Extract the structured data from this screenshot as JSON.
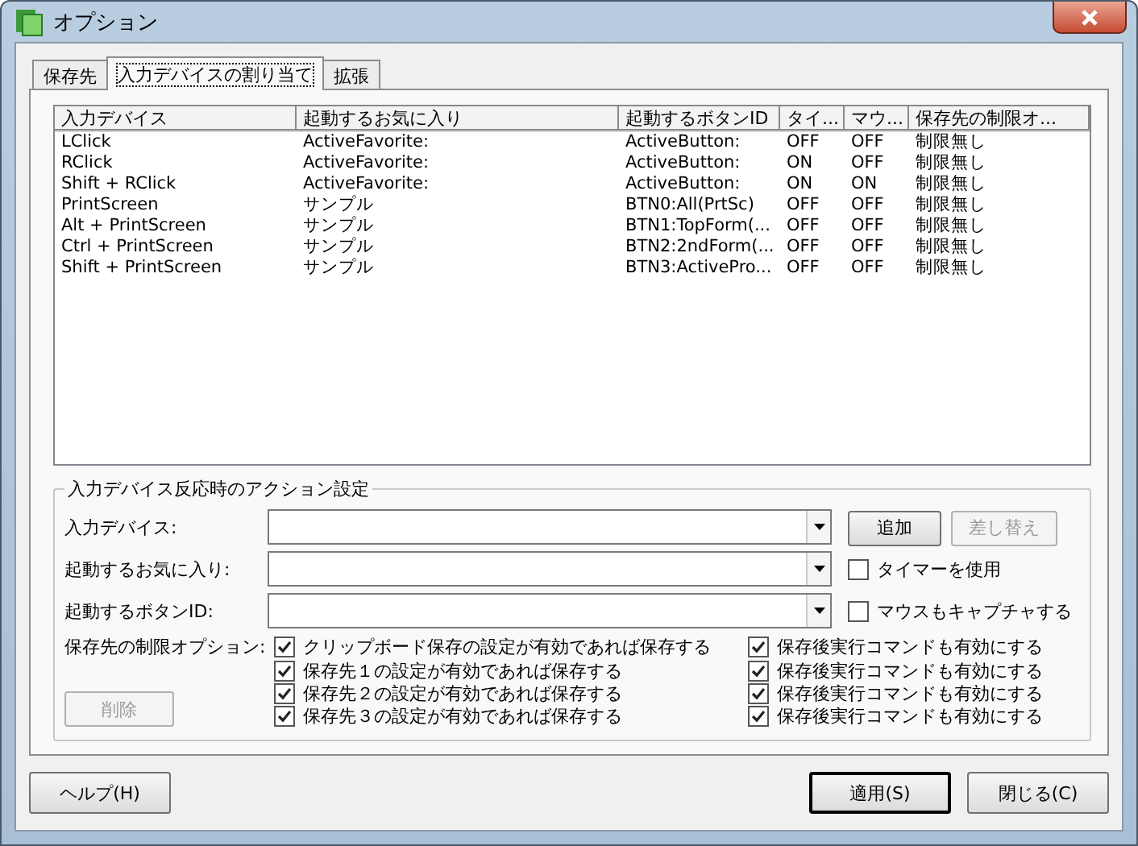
{
  "window": {
    "title": "オプション"
  },
  "tabs": [
    {
      "label": "保存先",
      "selected": false
    },
    {
      "label": "入力デバイスの割り当て",
      "selected": true
    },
    {
      "label": "拡張",
      "selected": false
    }
  ],
  "list": {
    "columns": [
      "入力デバイス",
      "起動するお気に入り",
      "起動するボタンID",
      "タイ...",
      "マウ...",
      "保存先の制限オ..."
    ],
    "rows": [
      [
        "LClick",
        "ActiveFavorite:",
        "ActiveButton:",
        "OFF",
        "OFF",
        "制限無し"
      ],
      [
        "RClick",
        "ActiveFavorite:",
        "ActiveButton:",
        "ON",
        "OFF",
        "制限無し"
      ],
      [
        "Shift + RClick",
        "ActiveFavorite:",
        "ActiveButton:",
        "ON",
        "ON",
        "制限無し"
      ],
      [
        "PrintScreen",
        "サンプル",
        "BTN0:All(PrtSc)",
        "OFF",
        "OFF",
        "制限無し"
      ],
      [
        "Alt + PrintScreen",
        "サンプル",
        "BTN1:TopForm(...",
        "OFF",
        "OFF",
        "制限無し"
      ],
      [
        "Ctrl + PrintScreen",
        "サンプル",
        "BTN2:2ndForm(...",
        "OFF",
        "OFF",
        "制限無し"
      ],
      [
        "Shift + PrintScreen",
        "サンプル",
        "BTN3:ActivePro...",
        "OFF",
        "OFF",
        "制限無し"
      ]
    ]
  },
  "action_group": {
    "title": "入力デバイス反応時のアクション設定",
    "fields": [
      {
        "label": "入力デバイス:"
      },
      {
        "label": "起動するお気に入り:"
      },
      {
        "label": "起動するボタンID:"
      }
    ],
    "side": [
      {
        "kind": "button",
        "label": "追加",
        "disabled": false
      },
      {
        "kind": "button",
        "label": "差し替え",
        "disabled": true
      },
      {
        "kind": "checkbox",
        "label": "タイマーを使用",
        "checked": false
      },
      {
        "kind": "checkbox",
        "label": "マウスもキャプチャする",
        "checked": false
      }
    ],
    "restriction_label": "保存先の制限オプション:",
    "options": [
      {
        "label": "クリップボード保存の設定が有効であれば保存する",
        "checked": true,
        "command": {
          "label": "保存後実行コマンドも有効にする",
          "checked": true
        }
      },
      {
        "label": "保存先１の設定が有効であれば保存する",
        "checked": true,
        "command": {
          "label": "保存後実行コマンドも有効にする",
          "checked": true
        }
      },
      {
        "label": "保存先２の設定が有効であれば保存する",
        "checked": true,
        "command": {
          "label": "保存後実行コマンドも有効にする",
          "checked": true
        }
      },
      {
        "label": "保存先３の設定が有効であれば保存する",
        "checked": true,
        "command": {
          "label": "保存後実行コマンドも有効にする",
          "checked": true
        }
      }
    ],
    "delete_button": {
      "label": "削除",
      "disabled": true
    }
  },
  "footer": [
    {
      "label": "ヘルプ(H)",
      "default": false
    },
    {
      "label": "適用(S)",
      "default": true
    },
    {
      "label": "閉じる(C)",
      "default": false
    }
  ]
}
